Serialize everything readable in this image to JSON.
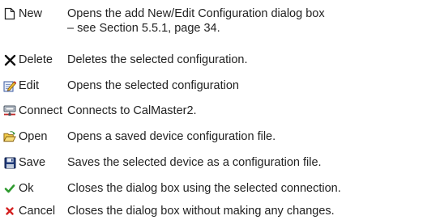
{
  "entries": [
    {
      "label": "New",
      "icon": "new-document-icon",
      "description_lines": [
        "Opens the add New/Edit Configuration dialog box",
        "– see Section 5.5.1, page 34."
      ]
    },
    {
      "label": "Delete",
      "icon": "delete-x-icon",
      "description_lines": [
        "Deletes the selected configuration."
      ]
    },
    {
      "label": "Edit",
      "icon": "edit-pencil-icon",
      "description_lines": [
        "Opens the selected configuration"
      ]
    },
    {
      "label": "Connect",
      "icon": "connect-network-icon",
      "description_lines": [
        "Connects to CalMaster2."
      ]
    },
    {
      "label": "Open",
      "icon": "open-folder-icon",
      "description_lines": [
        "Opens a saved device configuration file."
      ]
    },
    {
      "label": "Save",
      "icon": "save-floppy-icon",
      "description_lines": [
        "Saves the selected device as a configuration file."
      ]
    },
    {
      "label": "Ok",
      "icon": "checkmark-icon",
      "description_lines": [
        "Closes the dialog box using the selected connection."
      ]
    },
    {
      "label": "Cancel",
      "icon": "cancel-x-icon",
      "description_lines": [
        "Closes the dialog box without making any changes."
      ]
    }
  ],
  "colors": {
    "text": "#222222",
    "ok_green": "#2e9a2e",
    "cancel_red": "#d42020",
    "folder_yellow": "#e8b828",
    "save_blue": "#1f3a7a"
  }
}
